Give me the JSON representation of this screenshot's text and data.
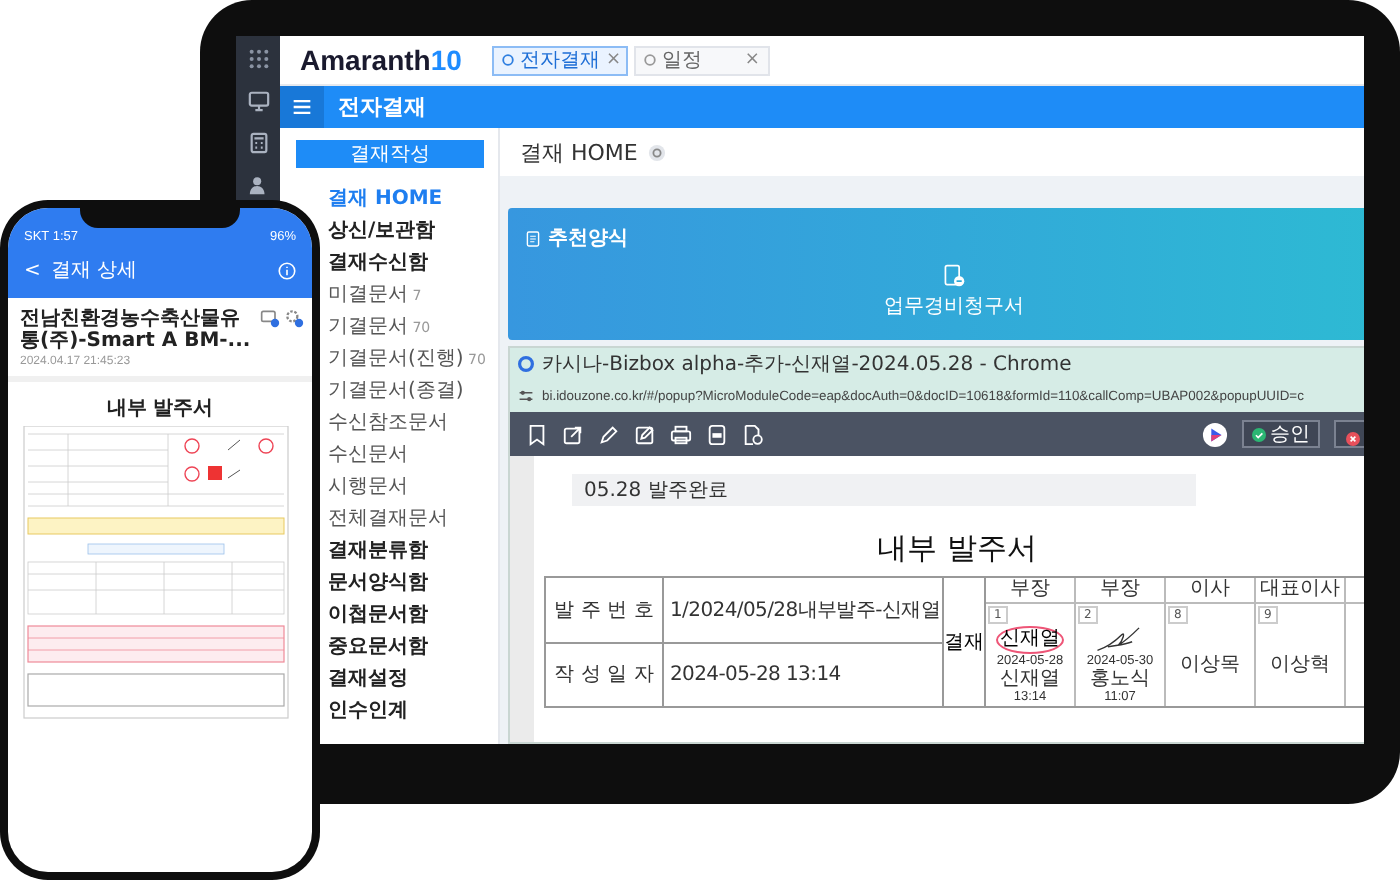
{
  "tablet": {
    "logo": {
      "name": "Amaranth",
      "version": "10"
    },
    "tabs": [
      {
        "label": "전자결재",
        "selected": true,
        "close": "×"
      },
      {
        "label": "일정",
        "selected": false,
        "close": "×"
      }
    ],
    "module_title": "전자결재",
    "write_button": "결재작성",
    "sidebar": {
      "items": [
        {
          "label": "결재 HOME",
          "selected": true
        },
        {
          "label": "상신/보관함",
          "selected": false
        },
        {
          "label": "결재수신함",
          "selected": false,
          "children": [
            {
              "label": "미결문서",
              "count": "7",
              "selected": false
            },
            {
              "label": "기결문서",
              "count": "70",
              "selected": false
            },
            {
              "label": "기결문서(진행)",
              "count": "70",
              "selected": false
            },
            {
              "label": "기결문서(종결)",
              "selected": false
            },
            {
              "label": "수신참조문서",
              "selected": false
            },
            {
              "label": "수신문서",
              "selected": false
            },
            {
              "label": "시행문서",
              "selected": false
            },
            {
              "label": "전체결재문서",
              "selected": false
            }
          ]
        },
        {
          "label": "결재분류함",
          "selected": false
        },
        {
          "label": "문서양식함",
          "selected": false
        },
        {
          "label": "이첩문서함",
          "selected": false
        },
        {
          "label": "중요문서함",
          "selected": false
        },
        {
          "label": "결재설정",
          "selected": false
        },
        {
          "label": "인수인계",
          "selected": false
        }
      ]
    },
    "page_title": "결재 HOME",
    "recommended": {
      "title": "추천양식",
      "items": [
        {
          "label": "업무경비청구서"
        }
      ]
    },
    "popup": {
      "title": "카시나-Bizbox alpha-추가-신재열-2024.05.28 - Chrome",
      "url": "bi.idouzone.co.kr/#/popup?MicroModuleCode=eap&docAuth=0&docID=10618&formId=110&callComp=UBAP002&popupUUID=c",
      "approve_button": "승인",
      "comment": "05.28 발주완료",
      "document": {
        "title": "내부 발주서",
        "fields": [
          {
            "label": "발 주 번 호",
            "value": "1/2024/05/28내부발주-신재열"
          },
          {
            "label": "작 성 일 자",
            "value": "2024-05-28 13:14"
          }
        ],
        "approval": {
          "label": "결재",
          "steps": [
            {
              "position": "부장",
              "number": "1",
              "kind": "stamp",
              "stamp": "신재열",
              "date": "2024-05-28",
              "name": "신재열",
              "time": "13:14"
            },
            {
              "position": "부장",
              "number": "2",
              "kind": "signature",
              "date": "2024-05-30",
              "name": "홍노식",
              "time": "11:07"
            },
            {
              "position": "이사",
              "number": "8",
              "kind": "pending",
              "name": "이상목"
            },
            {
              "position": "대표이사",
              "number": "9",
              "kind": "pending",
              "name": "이상혁"
            }
          ]
        }
      }
    }
  },
  "phone": {
    "carrier_time": "SKT 1:57",
    "battery": "96%",
    "back": "<",
    "header": "결재 상세",
    "doc_title": "전남친환경농수축산물유통(주)-Smart A BM-...",
    "doc_date": "2024.04.17 21:45:23",
    "doc_heading": "내부 발주서"
  }
}
